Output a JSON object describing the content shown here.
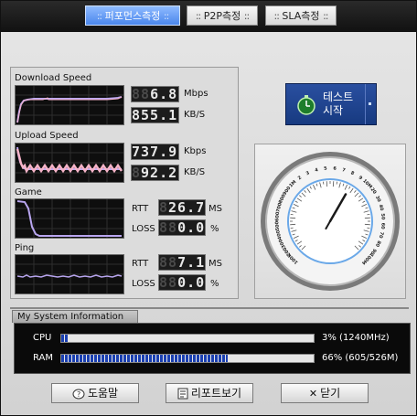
{
  "tabs": [
    {
      "label": "퍼포먼스측정",
      "active": true
    },
    {
      "label": "P2P측정",
      "active": false
    },
    {
      "label": "SLA측정",
      "active": false
    }
  ],
  "tab_dots": "::",
  "download": {
    "label": "Download Speed",
    "mbps_ghost": "88",
    "mbps": "6.8",
    "mbps_unit": "Mbps",
    "kbs_ghost": "",
    "kbs": "855.1",
    "kbs_unit": "KB/S"
  },
  "upload": {
    "label": "Upload Speed",
    "kbps_ghost": "",
    "kbps": "737.9",
    "kbps_unit": "Kbps",
    "kbs_ghost": "8",
    "kbs": "92.2",
    "kbs_unit": "KB/S"
  },
  "game": {
    "label": "Game",
    "rtt_label": "RTT",
    "rtt_ghost": "8",
    "rtt": "26.7",
    "rtt_unit": "MS",
    "loss_label": "LOSS",
    "loss_ghost": "88",
    "loss": "0.0",
    "loss_unit": "%"
  },
  "ping": {
    "label": "Ping",
    "rtt_label": "RTT",
    "rtt_ghost": "88",
    "rtt": "7.1",
    "rtt_unit": "MS",
    "loss_label": "LOSS",
    "loss_ghost": "88",
    "loss": "0.0",
    "loss_unit": "%"
  },
  "start_button": {
    "line1": "테스트",
    "line2": "시작"
  },
  "gauge": {
    "ticks": [
      "100K",
      "200",
      "300",
      "400",
      "500",
      "600",
      "700",
      "800",
      "900",
      "1M",
      "2",
      "3",
      "4",
      "5",
      "6",
      "7",
      "8",
      "9",
      "10M",
      "20",
      "30",
      "40",
      "50",
      "60",
      "70",
      "80",
      "90",
      "100M"
    ],
    "needle_value_mbps": 6.8
  },
  "system": {
    "title": "My System Information",
    "cpu_label": "CPU",
    "cpu_value": "3% (1240MHz)",
    "cpu_fraction": 0.03,
    "ram_label": "RAM",
    "ram_value": "66% (605/526M)",
    "ram_fraction": 0.66
  },
  "buttons": {
    "help": "도움말",
    "report": "리포트보기",
    "close": "닫기"
  },
  "colors": {
    "accent": "#4a86ec",
    "lcd_text": "#e8e8e8",
    "graph_trace_pink": "#f6b3c8",
    "graph_trace_lilac": "#b9a6f0",
    "bar_fill": "#1a3fb0"
  }
}
